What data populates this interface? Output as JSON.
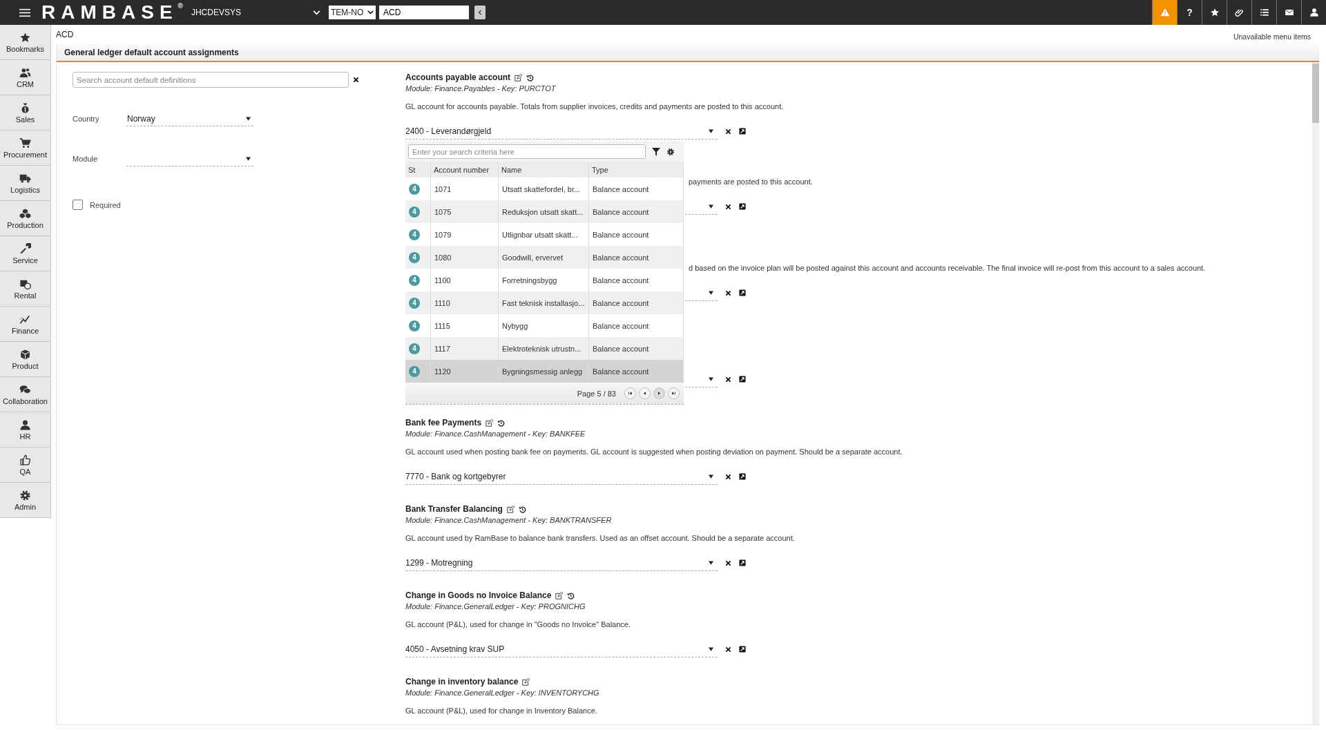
{
  "topbar": {
    "logo": "RAMBASE",
    "logo_mark": "®",
    "system": "JHCDEVSYS",
    "company": "TEM-NO",
    "program_field": "ACD",
    "actions": [
      {
        "kind": "warning",
        "highlighted": true
      },
      {
        "kind": "help",
        "glyph": "?",
        "highlighted": false
      },
      {
        "kind": "star",
        "highlighted": false
      },
      {
        "kind": "paperclip",
        "highlighted": false
      },
      {
        "kind": "list",
        "highlighted": false
      },
      {
        "kind": "mail",
        "highlighted": false
      },
      {
        "kind": "user",
        "highlighted": false
      }
    ]
  },
  "sidebar": {
    "items": [
      {
        "kind": "star",
        "label": "Bookmarks"
      },
      {
        "kind": "people",
        "label": "CRM"
      },
      {
        "kind": "moneybag",
        "label": "Sales"
      },
      {
        "kind": "cart",
        "label": "Procurement"
      },
      {
        "kind": "truck",
        "label": "Logistics"
      },
      {
        "kind": "cubes",
        "label": "Production"
      },
      {
        "kind": "wrench",
        "label": "Service"
      },
      {
        "kind": "calendar",
        "label": "Rental"
      },
      {
        "kind": "chart",
        "label": "Finance"
      },
      {
        "kind": "cube",
        "label": "Product"
      },
      {
        "kind": "chat",
        "label": "Collaboration"
      },
      {
        "kind": "person",
        "label": "HR"
      },
      {
        "kind": "thumb",
        "label": "QA"
      },
      {
        "kind": "gear",
        "label": "Admin"
      }
    ]
  },
  "program": "ACD",
  "unavailable_menu": "Unavailable menu items",
  "panel_title": "General ledger default account assignments",
  "filters": {
    "search_placeholder": "Search account default definitions",
    "country": {
      "label": "Country",
      "value": "Norway"
    },
    "module": {
      "label": "Module"
    },
    "required": {
      "label": "Required",
      "checked": false
    }
  },
  "sections": [
    {
      "kind": "full",
      "title": "Accounts payable account",
      "resettable": true,
      "module_key": "Module: Finance.Payables - Key: PURCTOT",
      "description": "GL account for accounts payable. Totals from supplier invoices, credits and payments are posted to this account.",
      "account": "2400 - Leverandørgjeld",
      "picker": {
        "search_placeholder": "Enter your search criteria here",
        "columns": [
          "St",
          "Account number",
          "Name",
          "Type"
        ],
        "rows": [
          {
            "status": "4",
            "number": "1071",
            "name": "Utsatt skattefordel, br...",
            "type": "Balance account",
            "selected": false
          },
          {
            "status": "4",
            "number": "1075",
            "name": "Reduksjon utsatt skatt...",
            "type": "Balance account",
            "selected": false
          },
          {
            "status": "4",
            "number": "1079",
            "name": "Utlignbar utsatt skatt...",
            "type": "Balance account",
            "selected": false
          },
          {
            "status": "4",
            "number": "1080",
            "name": "Goodwill, ervervet",
            "type": "Balance account",
            "selected": false
          },
          {
            "status": "4",
            "number": "1100",
            "name": "Forretningsbygg",
            "type": "Balance account",
            "selected": false
          },
          {
            "status": "4",
            "number": "1110",
            "name": "Fast teknisk installasjo...",
            "type": "Balance account",
            "selected": false
          },
          {
            "status": "4",
            "number": "1115",
            "name": "Nybygg",
            "type": "Balance account",
            "selected": false
          },
          {
            "status": "4",
            "number": "1117",
            "name": "Elektroteknisk utrustn...",
            "type": "Balance account",
            "selected": false
          },
          {
            "status": "4",
            "number": "1120",
            "name": "Bygningsmessig anlegg",
            "type": "Balance account",
            "selected": true
          }
        ],
        "page": "Page 5 / 83",
        "pager": [
          {
            "kind": "first",
            "hovered": false
          },
          {
            "kind": "prev",
            "hovered": false
          },
          {
            "kind": "next",
            "hovered": true
          },
          {
            "kind": "last",
            "hovered": false
          }
        ]
      }
    },
    {
      "kind": "covered",
      "description": "payments are posted to this account."
    },
    {
      "kind": "covered",
      "description": "d based on the invoice plan will be posted against this account and accounts receivable. The final invoice will re-post from this account to a sales account."
    },
    {
      "kind": "covered"
    },
    {
      "kind": "full",
      "title": "Bank fee Payments",
      "resettable": true,
      "module_key": "Module: Finance.CashManagement - Key: BANKFEE",
      "description": "GL account used when posting bank fee on payments. GL account is suggested when posting deviation on payment. Should be a separate account.",
      "account": "7770 - Bank og kortgebyrer"
    },
    {
      "kind": "full",
      "title": "Bank Transfer Balancing",
      "resettable": true,
      "module_key": "Module: Finance.CashManagement - Key: BANKTRANSFER",
      "description": "GL account used by RamBase to balance bank transfers. Used as an offset account. Should be a separate account.",
      "account": "1299 - Motregning"
    },
    {
      "kind": "full",
      "title": "Change in Goods no Invoice Balance",
      "resettable": true,
      "module_key": "Module: Finance.GeneralLedger - Key: PROGNICHG",
      "description": "GL account (P&L), used for change in \"Goods no Invoice\" Balance.",
      "account": "4050 - Avsetning krav SUP"
    },
    {
      "kind": "full",
      "title": "Change in inventory balance",
      "resettable": false,
      "module_key": "Module: Finance.GeneralLedger - Key: INVENTORYCHG",
      "description": "GL account (P&L), used for change in Inventory Balance."
    }
  ]
}
